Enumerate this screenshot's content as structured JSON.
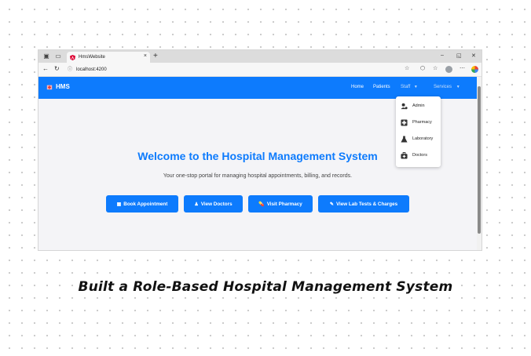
{
  "browser": {
    "tab_title": "HmsWebsite",
    "tab_close": "×",
    "new_tab": "+",
    "url": "localhost:4200",
    "window_controls": {
      "minimize": "–",
      "restore": "◱",
      "close": "✕"
    },
    "icons": [
      "back-icon",
      "refresh-icon",
      "star-icon",
      "extensions-icon",
      "favorites-icon",
      "profile-icon",
      "menu-icon",
      "copilot-icon"
    ]
  },
  "navbar": {
    "brand": "HMS",
    "links": [
      "Home",
      "Patients",
      "Staff",
      "Services"
    ],
    "accent": "#0d7bfd"
  },
  "staff_dropdown": {
    "items": [
      "Admin",
      "Pharmacy",
      "Laboratory",
      "Doctors"
    ]
  },
  "hero": {
    "title": "Welcome to the Hospital Management System",
    "subtitle": "Your one-stop portal for managing hospital appointments, billing, and records.",
    "buttons": [
      "Book Appointment",
      "View Doctors",
      "Visit Pharmacy",
      "View Lab Tests & Charges"
    ]
  },
  "caption": "Built a Role-Based Hospital Management System"
}
